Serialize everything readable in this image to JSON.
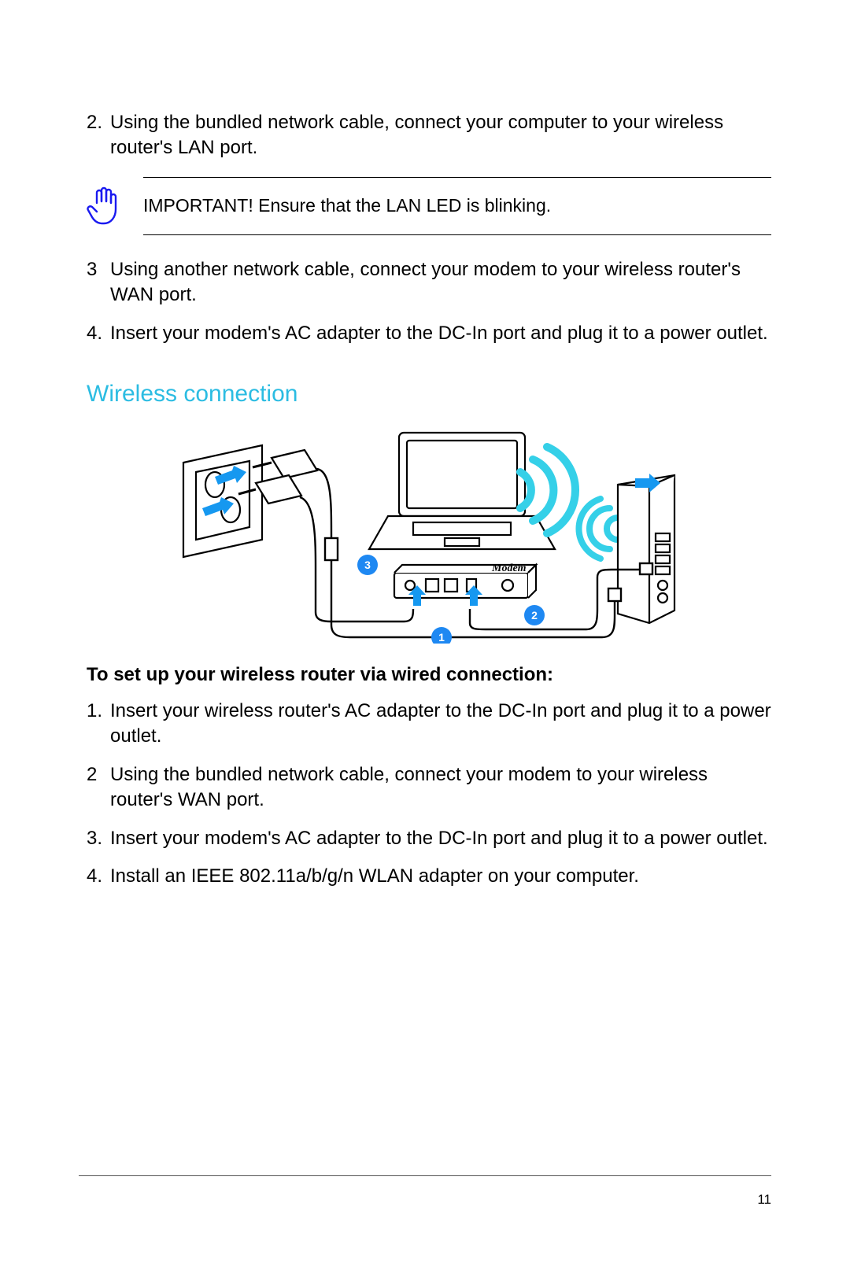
{
  "steps_top": [
    {
      "num": "2.",
      "text": "Using the bundled network cable, connect your computer to your wireless router's LAN port."
    },
    {
      "num": "3",
      "text": "Using another network cable, connect your modem to your wireless router's WAN port."
    },
    {
      "num": "4.",
      "text": "Insert your modem's AC adapter to the DC-In port and plug it to a power outlet."
    }
  ],
  "callout_text": "IMPORTANT!  Ensure that the LAN LED is blinking.",
  "section_title": "Wireless connection",
  "sub_title": "To set up your wireless router via wired connection:",
  "steps_bottom": [
    {
      "num": "1.",
      "text": "Insert your wireless router's AC adapter to the DC-In port and plug it to a power outlet."
    },
    {
      "num": "2",
      "text": "Using the bundled network cable, connect your modem to your wireless router's WAN port."
    },
    {
      "num": "3.",
      "text": "Insert your modem's AC adapter to the DC-In port and plug it to a power outlet."
    },
    {
      "num": "4.",
      "text": "Install an IEEE 802.11a/b/g/n WLAN adapter on your computer."
    }
  ],
  "diagram": {
    "modem_label": "Modem",
    "markers": {
      "m1": "1",
      "m2": "2",
      "m3": "3"
    }
  },
  "page_number": "11"
}
